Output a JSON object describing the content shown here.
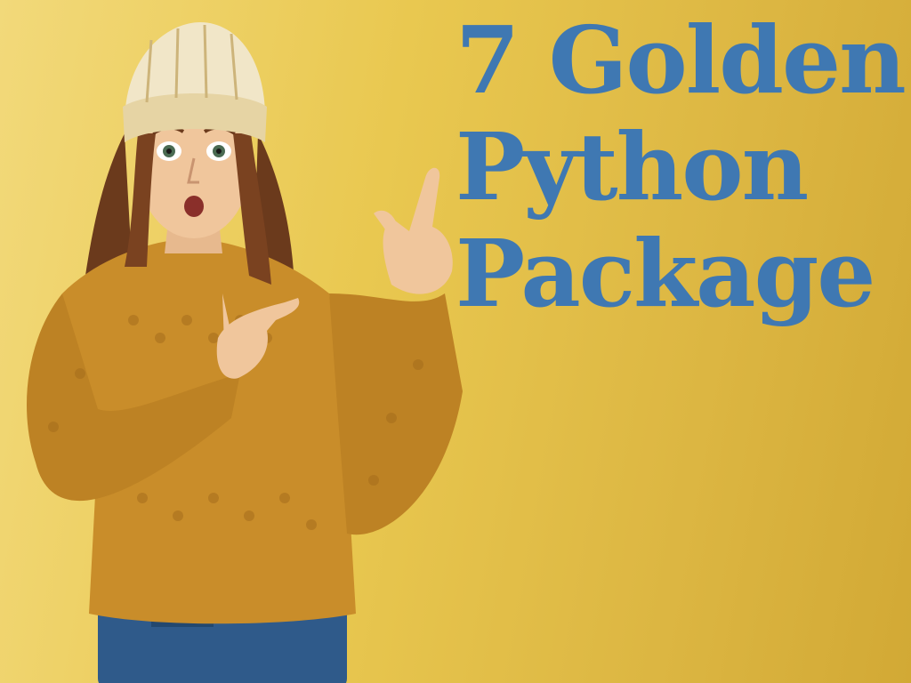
{
  "headline": {
    "line1": "7 Golden",
    "line2": "Python",
    "line3": "Package"
  },
  "colors": {
    "background": "#e6c24d",
    "headline": "#3f78b2",
    "sweater": "#c98d2a",
    "jeans": "#2f5a8a",
    "beanie": "#f1e6c8"
  },
  "icons": {
    "person": "woman-pointing-photo"
  }
}
